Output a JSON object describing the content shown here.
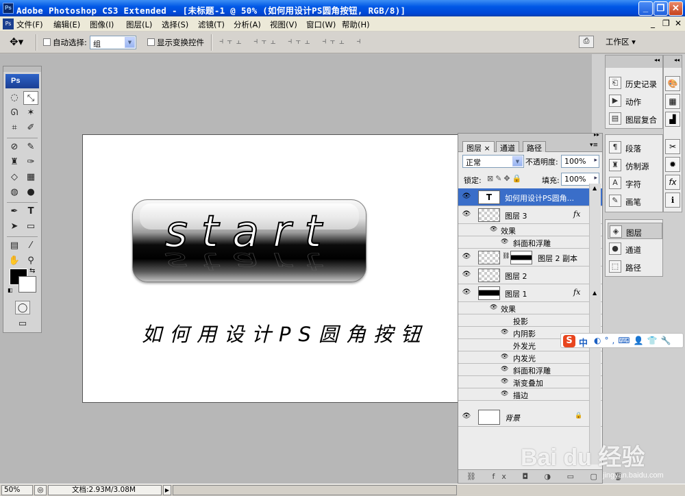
{
  "window": {
    "title": "Adobe Photoshop CS3 Extended - [未标题-1 @ 50% (如何用设计PS圆角按钮, RGB/8)]",
    "app_icon": "Ps",
    "minimize": "_",
    "maximize": "❐",
    "close": "✕"
  },
  "menu": {
    "items": [
      "文件(F)",
      "编辑(E)",
      "图像(I)",
      "图层(L)",
      "选择(S)",
      "滤镜(T)",
      "分析(A)",
      "视图(V)",
      "窗口(W)",
      "帮助(H)"
    ],
    "doc_minimize": "_",
    "doc_restore": "❐",
    "doc_close": "✕"
  },
  "options": {
    "auto_select_label": "自动选择:",
    "auto_select_value": "组",
    "show_transform_label": "显示变换控件",
    "workspace_label": "工作区 ▾",
    "align_icons": "⫞⫟⫠ ⫞⫟⫠ ⫞⫟⫠ ⫞⫟⫠ ⫞"
  },
  "toolbox": {
    "logo": "Ps"
  },
  "canvas": {
    "button_text": "start",
    "caption": "如何用设计PS圆角按钮"
  },
  "layers_panel": {
    "tabs": [
      "图层 ×",
      "通道",
      "路径"
    ],
    "blend_mode": "正常",
    "opacity_label": "不透明度:",
    "opacity_value": "100%",
    "lock_label": "锁定:",
    "fill_label": "填充:",
    "fill_value": "100%",
    "layers": [
      {
        "name": "如何用设计PS圆角...",
        "thumb": "T",
        "selected": true
      },
      {
        "name": "图层 3",
        "fx": "fx"
      },
      {
        "name": "效果",
        "sub": true
      },
      {
        "name": "斜面和浮雕",
        "sub": true
      },
      {
        "name": "图层 2 副本"
      },
      {
        "name": "图层 2"
      },
      {
        "name": "图层 1",
        "fx": "fx"
      },
      {
        "name": "效果",
        "sub": true
      },
      {
        "name": "投影",
        "sub": true
      },
      {
        "name": "内阴影",
        "sub": true
      },
      {
        "name": "外发光",
        "sub": true
      },
      {
        "name": "内发光",
        "sub": true
      },
      {
        "name": "斜面和浮雕",
        "sub": true
      },
      {
        "name": "渐变叠加",
        "sub": true
      },
      {
        "name": "描边",
        "sub": true
      },
      {
        "name": "背景",
        "locked": true
      }
    ],
    "bottom_icons": "⛓ fx ◘ ◑ ▭ ▢ 🗑"
  },
  "dock": {
    "group1": [
      "历史记录",
      "动作",
      "图层复合"
    ],
    "group2": [
      "段落",
      "仿制源",
      "字符",
      "画笔"
    ],
    "group3": [
      "图层",
      "通道",
      "路径"
    ]
  },
  "status": {
    "zoom": "50%",
    "doc_info": "文档:2.93M/3.08M"
  },
  "ime": {
    "logo": "S",
    "mode": "中",
    "icons": "◐°,⌨👤👕🔧"
  },
  "watermark": {
    "text": "Bai du 经验",
    "url": "jingyan.baidu.com"
  }
}
